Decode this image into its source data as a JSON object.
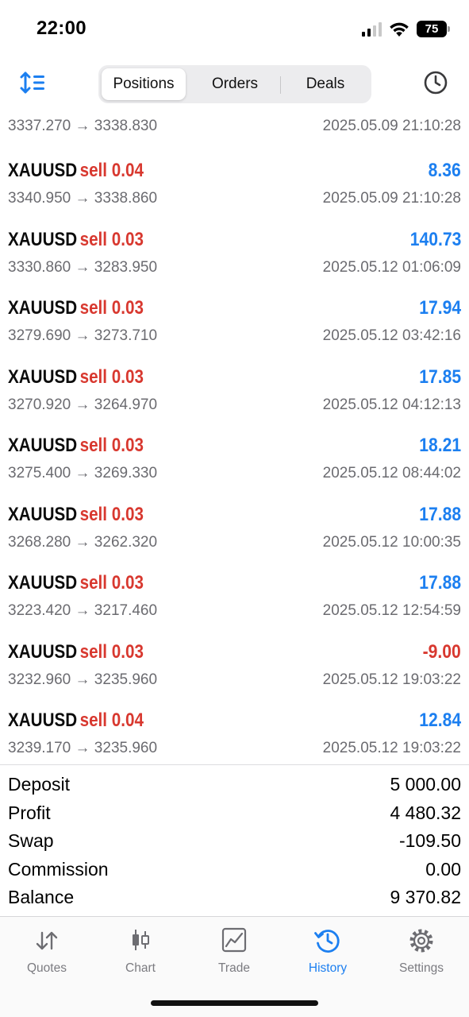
{
  "status_bar": {
    "time": "22:00",
    "battery": "75",
    "icons": [
      "signal-icon",
      "wifi-icon",
      "battery-icon"
    ]
  },
  "toolbar": {
    "tabs": [
      {
        "label": "Positions",
        "active": true
      },
      {
        "label": "Orders",
        "active": false
      },
      {
        "label": "Deals",
        "active": false
      }
    ],
    "left_icon": "sort-icon",
    "right_icon": "clock-icon"
  },
  "colors": {
    "accent": "#1c7ff0",
    "sell": "#d8382f",
    "profit_positive": "#1c7ff0",
    "profit_negative": "#d8382f"
  },
  "partial_row": {
    "prices": "3337.270 → 3338.830",
    "time": "2025.05.09 21:10:28"
  },
  "deals": [
    {
      "symbol": "XAUUSD",
      "type": "sell",
      "volume": "0.04",
      "profit": "8.36",
      "positive": true,
      "prices": "3340.950 → 3338.860",
      "time": "2025.05.09 21:10:28"
    },
    {
      "symbol": "XAUUSD",
      "type": "sell",
      "volume": "0.03",
      "profit": "140.73",
      "positive": true,
      "prices": "3330.860 → 3283.950",
      "time": "2025.05.12 01:06:09"
    },
    {
      "symbol": "XAUUSD",
      "type": "sell",
      "volume": "0.03",
      "profit": "17.94",
      "positive": true,
      "prices": "3279.690 → 3273.710",
      "time": "2025.05.12 03:42:16"
    },
    {
      "symbol": "XAUUSD",
      "type": "sell",
      "volume": "0.03",
      "profit": "17.85",
      "positive": true,
      "prices": "3270.920 → 3264.970",
      "time": "2025.05.12 04:12:13"
    },
    {
      "symbol": "XAUUSD",
      "type": "sell",
      "volume": "0.03",
      "profit": "18.21",
      "positive": true,
      "prices": "3275.400 → 3269.330",
      "time": "2025.05.12 08:44:02"
    },
    {
      "symbol": "XAUUSD",
      "type": "sell",
      "volume": "0.03",
      "profit": "17.88",
      "positive": true,
      "prices": "3268.280 → 3262.320",
      "time": "2025.05.12 10:00:35"
    },
    {
      "symbol": "XAUUSD",
      "type": "sell",
      "volume": "0.03",
      "profit": "17.88",
      "positive": true,
      "prices": "3223.420 → 3217.460",
      "time": "2025.05.12 12:54:59"
    },
    {
      "symbol": "XAUUSD",
      "type": "sell",
      "volume": "0.03",
      "profit": "-9.00",
      "positive": false,
      "prices": "3232.960 → 3235.960",
      "time": "2025.05.12 19:03:22"
    },
    {
      "symbol": "XAUUSD",
      "type": "sell",
      "volume": "0.04",
      "profit": "12.84",
      "positive": true,
      "prices": "3239.170 → 3235.960",
      "time": "2025.05.12 19:03:22"
    }
  ],
  "summary": [
    {
      "label": "Deposit",
      "value": "5 000.00"
    },
    {
      "label": "Profit",
      "value": "4 480.32"
    },
    {
      "label": "Swap",
      "value": "-109.50"
    },
    {
      "label": "Commission",
      "value": "0.00"
    },
    {
      "label": "Balance",
      "value": "9 370.82"
    }
  ],
  "tabbar": [
    {
      "label": "Quotes",
      "icon": "quotes-icon",
      "active": false
    },
    {
      "label": "Chart",
      "icon": "chart-icon",
      "active": false
    },
    {
      "label": "Trade",
      "icon": "trade-icon",
      "active": false
    },
    {
      "label": "History",
      "icon": "history-icon",
      "active": true
    },
    {
      "label": "Settings",
      "icon": "settings-icon",
      "active": false
    }
  ]
}
